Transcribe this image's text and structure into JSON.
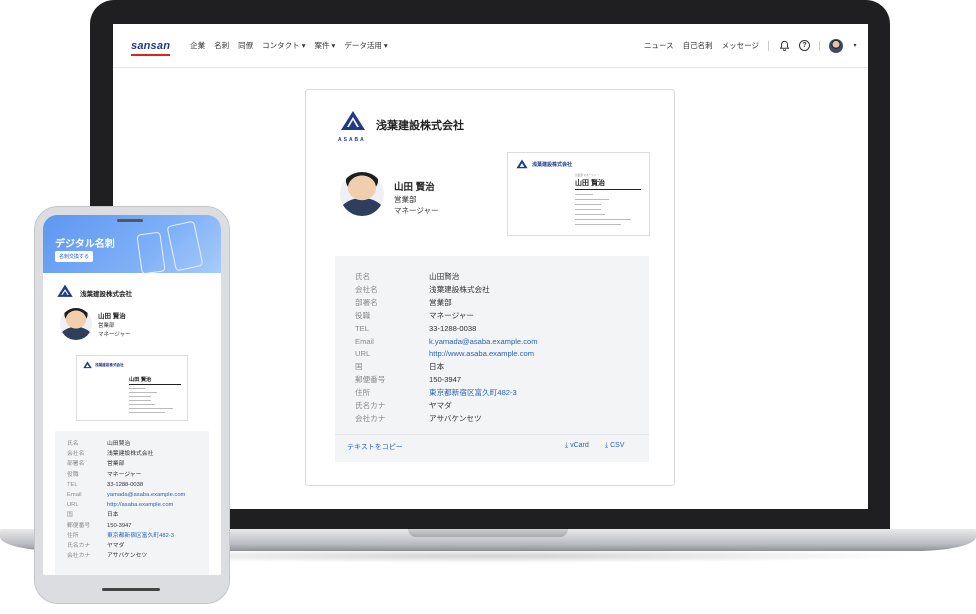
{
  "app": {
    "logo": "sansan",
    "nav": {
      "links": [
        "企業",
        "名刺",
        "同僚",
        "コンタクト ▾",
        "案件 ▾",
        "データ活用 ▾"
      ],
      "news": "ニュース",
      "my_card": "自己名刺",
      "message": "メッセージ"
    },
    "icons": {
      "bell": "bell-icon",
      "help": "help-icon",
      "avatar": "user-avatar"
    },
    "colors": {
      "brand_blue": "#1f3a8a",
      "brand_red": "#d9251d",
      "link": "#2a63b8",
      "hero_blue": "#5e97f2"
    }
  },
  "card": {
    "company_logo_text": "ASABA",
    "company": "浅葉建設株式会社",
    "person_name": "山田 賢治",
    "department": "営業部",
    "title": "マネージャー",
    "thumbnail": {
      "company": "浅葉建設株式会社",
      "name": "山田 賢治",
      "sub": "営業部 マネージャー"
    },
    "fields": [
      {
        "key": "氏名",
        "value": "山田賢治",
        "link": false
      },
      {
        "key": "会社名",
        "value": "浅葉建設株式会社",
        "link": false
      },
      {
        "key": "部署名",
        "value": "営業部",
        "link": false
      },
      {
        "key": "役職",
        "value": "マネージャー",
        "link": false
      },
      {
        "key": "TEL",
        "value": "33-1288-0038",
        "link": false
      },
      {
        "key": "Email",
        "value": "k.yamada@asaba.example.com",
        "link": true
      },
      {
        "key": "URL",
        "value": "http://www.asaba.example.com",
        "link": true
      },
      {
        "key": "国",
        "value": "日本",
        "link": false
      },
      {
        "key": "郵便番号",
        "value": "150-3947",
        "link": false
      },
      {
        "key": "住所",
        "value": "東京都新宿区富久町482-3",
        "link": true
      },
      {
        "key": "氏名カナ",
        "value": "ヤマダ",
        "link": false
      },
      {
        "key": "会社カナ",
        "value": "アサバケンセツ",
        "link": false
      }
    ],
    "copy_text": "テキストをコピー",
    "vcard": "vCard",
    "csv": "CSV"
  },
  "phone": {
    "hero_title": "デジタル名刺",
    "hero_button": "名刺交換する",
    "company": "浅葉建設株式会社",
    "person_name": "山田 賢治",
    "department": "営業部",
    "title": "マネージャー",
    "thumbnail": {
      "company": "浅葉建設株式会社",
      "name": "山田 賢治"
    },
    "fields": [
      {
        "key": "氏名",
        "value": "山田賢治",
        "link": false
      },
      {
        "key": "会社名",
        "value": "浅葉建設株式会社",
        "link": false
      },
      {
        "key": "部署名",
        "value": "営業部",
        "link": false
      },
      {
        "key": "役職",
        "value": "マネージャー",
        "link": false
      },
      {
        "key": "TEL",
        "value": "33-1288-0038",
        "link": false
      },
      {
        "key": "Email",
        "value": "yamada@asaba.example.com",
        "link": true
      },
      {
        "key": "URL",
        "value": "http://asaba.example.com",
        "link": true
      },
      {
        "key": "国",
        "value": "日本",
        "link": false
      },
      {
        "key": "郵便番号",
        "value": "150-3947",
        "link": false
      },
      {
        "key": "住所",
        "value": "東京都新宿区富久町482-3",
        "link": true
      },
      {
        "key": "氏名カナ",
        "value": "ヤマダ",
        "link": false
      },
      {
        "key": "会社カナ",
        "value": "アサバケンセツ",
        "link": false
      }
    ]
  }
}
